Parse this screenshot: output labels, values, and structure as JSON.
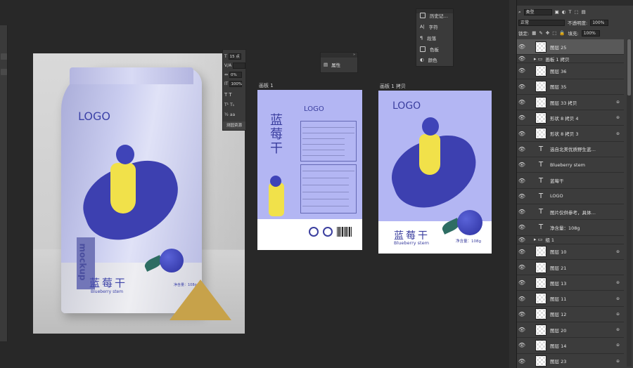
{
  "char_panel": {
    "size": "15 点",
    "leading": "",
    "tracking": "0%",
    "scale": "100%",
    "footer": "测园资源"
  },
  "props_panel": {
    "label": "属性"
  },
  "history_panel": {
    "items": [
      {
        "label": "历史记…",
        "icon": "history-icon"
      },
      {
        "label": "字符",
        "icon": "character-icon"
      },
      {
        "label": "段落",
        "icon": "paragraph-icon"
      },
      {
        "label": "色板",
        "icon": "swatches-icon"
      },
      {
        "label": "颜色",
        "icon": "color-icon"
      }
    ]
  },
  "artboards": {
    "ab1": {
      "label": "画板 1",
      "logo": "LOGO",
      "title": "蓝莓干"
    },
    "ab2": {
      "label": "画板 1 拷贝",
      "logo": "LOGO",
      "cn": "蓝莓干",
      "en": "Blueberry stem",
      "net": "净含量：108g"
    }
  },
  "mockup": {
    "logo": "LOGO",
    "mock_label": "mockup",
    "cn": "蓝莓干",
    "en": "Blueberry stem",
    "net": "净含量：108g"
  },
  "layers": {
    "filter": "类型",
    "blend": "正常",
    "opacity_label": "不透明度:",
    "opacity": "100%",
    "lock_label": "锁定:",
    "fill_label": "填充:",
    "fill": "100%",
    "items": [
      {
        "name": "图层 25",
        "kind": "image",
        "active": true
      },
      {
        "name": "画板 1 拷贝",
        "kind": "group"
      },
      {
        "name": "图层 36",
        "kind": "image"
      },
      {
        "name": "图层 35",
        "kind": "image"
      },
      {
        "name": "图层 33 拷贝",
        "kind": "image",
        "lock": true
      },
      {
        "name": "形状 8 拷贝 4",
        "kind": "image",
        "lock": true
      },
      {
        "name": "形状 8 拷贝 3",
        "kind": "image",
        "lock": true
      },
      {
        "name": "选自北美优质野生蓝…",
        "kind": "text"
      },
      {
        "name": "Blueberry stem",
        "kind": "text"
      },
      {
        "name": "蓝莓干",
        "kind": "text"
      },
      {
        "name": "LOGO",
        "kind": "text"
      },
      {
        "name": "图片仅供参考，具体…",
        "kind": "text"
      },
      {
        "name": "净含量：108g",
        "kind": "text"
      },
      {
        "name": "组 1",
        "kind": "group"
      },
      {
        "name": "图层 10",
        "kind": "image",
        "lock": true
      },
      {
        "name": "图层 21",
        "kind": "image"
      },
      {
        "name": "图层 13",
        "kind": "image",
        "lock": true
      },
      {
        "name": "图层 11",
        "kind": "image",
        "lock": true
      },
      {
        "name": "图层 12",
        "kind": "image",
        "lock": true
      },
      {
        "name": "图层 20",
        "kind": "image",
        "lock": true
      },
      {
        "name": "图层 14",
        "kind": "image",
        "lock": true
      },
      {
        "name": "图层 23",
        "kind": "image",
        "lock": true
      }
    ]
  },
  "colors": {
    "artboard_bg": "#b3b6f3",
    "brand_blue": "#3b3f9f",
    "canvas_bg": "#282828",
    "panel_bg": "#3c3c3c"
  }
}
